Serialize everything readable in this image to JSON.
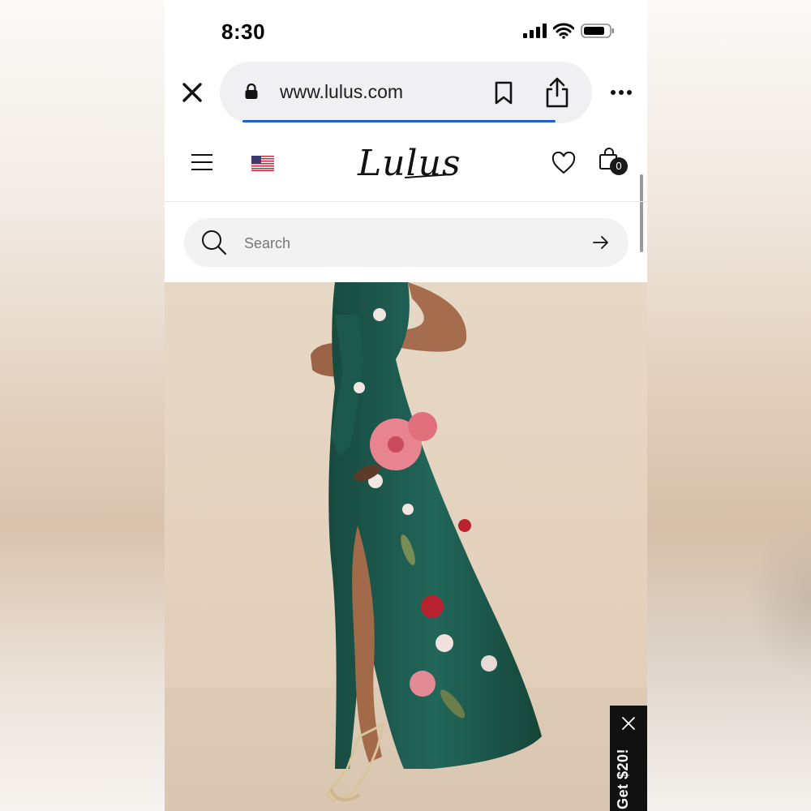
{
  "status_bar": {
    "time": "8:30",
    "icons": [
      "signal-icon",
      "wifi-icon",
      "battery-icon"
    ]
  },
  "browser": {
    "url": "www.lulus.com",
    "icons": [
      "close-icon",
      "lock-icon",
      "bookmark-icon",
      "share-icon",
      "more-icon"
    ],
    "progress_color": "#1f5fd1"
  },
  "site_header": {
    "logo": "Lulus",
    "cart_count": "0",
    "icons": [
      "menu-icon",
      "us-flag-icon",
      "heart-icon",
      "shopping-bag-icon"
    ]
  },
  "search": {
    "placeholder": "Search",
    "value": ""
  },
  "product": {
    "image": "model wearing green floral satin maxi dress with side slit and strappy heels",
    "colors": {
      "dress": "#1e5a4d",
      "background": "#e2d0bc",
      "flower": "#e8848f"
    }
  },
  "promo": {
    "label": "Get $20!"
  }
}
